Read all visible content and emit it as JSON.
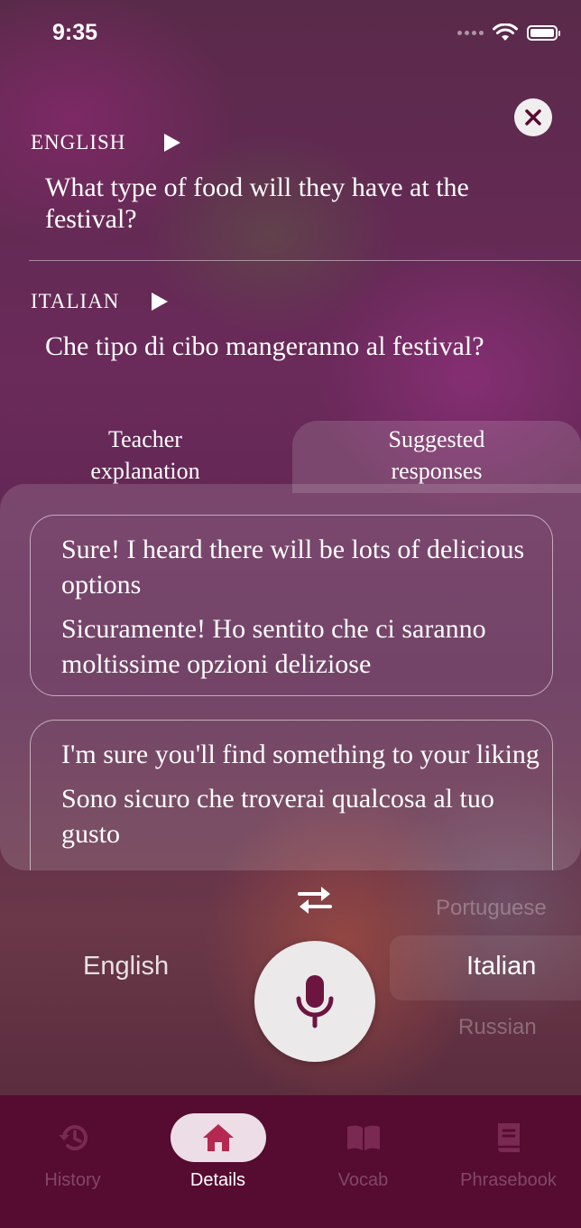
{
  "status_bar": {
    "time": "9:35"
  },
  "translation": {
    "source": {
      "language": "ENGLISH",
      "text": "What type of food will they have at the festival?"
    },
    "target": {
      "language": "ITALIAN",
      "text": "Che tipo di cibo mangeranno al festival?"
    }
  },
  "tabs": [
    {
      "label": "Teacher explanation",
      "selected": false
    },
    {
      "label": "Suggested responses",
      "selected": true
    }
  ],
  "suggested_responses": [
    {
      "english": "Sure! I heard there will be lots of delicious options",
      "italian": "Sicuramente! Ho sentito che ci saranno moltissime opzioni deliziose"
    },
    {
      "english": "I'm sure you'll find something to your liking",
      "italian": "Sono sicuro che troverai qualcosa al tuo gusto"
    }
  ],
  "language_switcher": {
    "source": "English",
    "target": "Italian",
    "target_above": "Portuguese",
    "target_below": "Russian"
  },
  "nav": [
    {
      "label": "History",
      "icon": "history-icon",
      "active": false
    },
    {
      "label": "Details",
      "icon": "home-icon",
      "active": true
    },
    {
      "label": "Vocab",
      "icon": "book-open-icon",
      "active": false
    },
    {
      "label": "Phrasebook",
      "icon": "phrasebook-icon",
      "active": false
    }
  ],
  "colors": {
    "nav_background": "#560b30",
    "accent": "#b5284f",
    "active_pill": "#ecdde6",
    "mic_icon": "#6b1540"
  }
}
